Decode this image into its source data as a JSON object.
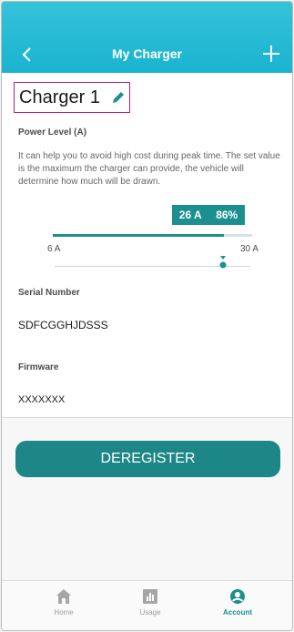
{
  "header": {
    "title": "My Charger"
  },
  "charger": {
    "name": "Charger 1"
  },
  "power": {
    "label": "Power Level (A)",
    "description": "It can help you to avoid high cost during peak time. The set value is the maximum the charger can provide, the vehicle will determine how much will be drawn.",
    "current": "26 A",
    "percent": "86%",
    "min_label": "6 A",
    "max_label": "30 A",
    "level_fraction": 0.86
  },
  "serial": {
    "label": "Serial Number",
    "value": "SDFCGGHJDSSS"
  },
  "firmware": {
    "label": "Firmware",
    "value": "XXXXXXX"
  },
  "actions": {
    "deregister": "DEREGISTER"
  },
  "tabs": [
    {
      "label": "Home",
      "icon": "home-icon"
    },
    {
      "label": "Usage",
      "icon": "bar-chart-icon"
    },
    {
      "label": "Account",
      "icon": "account-icon"
    }
  ],
  "colors": {
    "header": "#1ab3cf",
    "accent": "#1d8f8f",
    "highlight_border": "#b31e6f"
  }
}
